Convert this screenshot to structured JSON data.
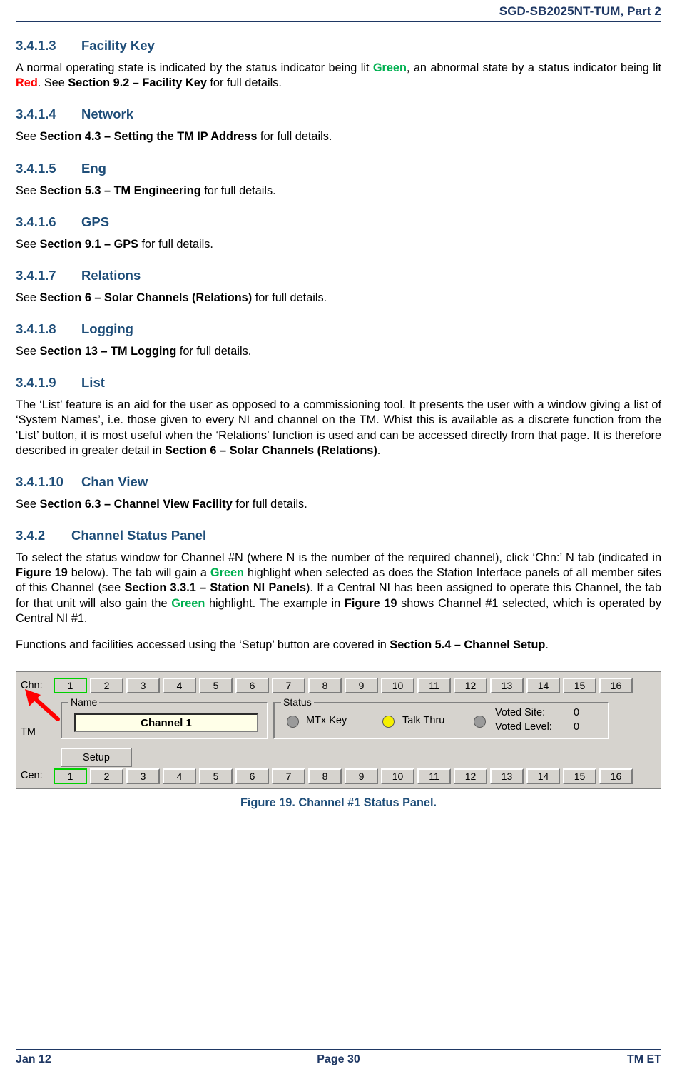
{
  "header": {
    "title": "SGD-SB2025NT-TUM, Part 2"
  },
  "sections": [
    {
      "num": "3.4.1.3",
      "title": "Facility Key",
      "paragraphs": [
        "A normal operating state is indicated by the status indicator being lit Green, an abnormal state by a status indicator being lit Red.  See Section 9.2 – Facility Key for full details."
      ]
    },
    {
      "num": "3.4.1.4",
      "title": "Network",
      "paragraphs": [
        "See Section 4.3 – Setting the TM IP Address for full details."
      ]
    },
    {
      "num": "3.4.1.5",
      "title": "Eng",
      "paragraphs": [
        "See Section 5.3 – TM Engineering for full details."
      ]
    },
    {
      "num": "3.4.1.6",
      "title": "GPS",
      "paragraphs": [
        "See Section 9.1 – GPS for full details."
      ]
    },
    {
      "num": "3.4.1.7",
      "title": "Relations",
      "paragraphs": [
        "See Section 6 – Solar Channels (Relations) for full details."
      ]
    },
    {
      "num": "3.4.1.8",
      "title": "Logging",
      "paragraphs": [
        "See Section 13 – TM Logging for full details."
      ]
    },
    {
      "num": "3.4.1.9",
      "title": "List",
      "paragraphs": [
        "The ‘List’ feature is an aid for the user as opposed to a commissioning tool.  It presents the user with a window giving a list of ‘System Names’, i.e. those given to every NI and channel on the TM.  Whist this is available as a discrete function from the ‘List’ button, it is most useful when the ‘Relations’ function is used and can be accessed directly from that page.  It is therefore described in greater detail in Section 6 – Solar Channels (Relations)."
      ]
    },
    {
      "num": "3.4.1.10",
      "title": "Chan View",
      "paragraphs": [
        "See Section 6.3 – Channel View Facility for full details."
      ]
    },
    {
      "num": "3.4.2",
      "title": "Channel Status Panel",
      "paragraphs": [
        "To select the status window for Channel #N (where N is the number of the required channel), click ‘Chn:’ N tab (indicated in Figure 19 below).  The tab will gain a Green highlight when selected as does the Station Interface panels of all member sites of this Channel (see Section 3.3.1 – Station NI Panels).  If a Central NI has been assigned to operate this Channel, the tab for that unit will also gain the Green highlight.  The example in Figure 19 shows Channel #1 selected, which is operated by Central NI #1.",
        "Functions and facilities accessed using the ‘Setup’ button are covered in Section 5.4 – Channel Setup."
      ]
    }
  ],
  "text_fragments": {
    "s3413_p1_a": "A normal operating state is indicated by the status indicator being lit ",
    "s3413_green": "Green",
    "s3413_p1_b": ", an abnormal state by a status indicator being lit ",
    "s3413_red": "Red",
    "s3413_p1_c": ".  See ",
    "s3413_ref": "Section 9.2 – Facility Key",
    "s3413_p1_d": " for full details.",
    "s3414_see": "See ",
    "s3414_ref": "Section 4.3 – Setting the TM IP Address",
    "s3414_tail": " for full details.",
    "s3415_see": "See ",
    "s3415_ref": "Section 5.3 – TM Engineering",
    "s3415_tail": " for full details.",
    "s3416_see": "See ",
    "s3416_ref": "Section 9.1 – GPS",
    "s3416_tail": " for full details.",
    "s3417_see": "See ",
    "s3417_ref": "Section 6 – Solar Channels (Relations)",
    "s3417_tail": " for full details.",
    "s3418_see": "See ",
    "s3418_ref": "Section 13 – TM Logging",
    "s3418_tail": " for full details.",
    "s3419_body": "The ‘List’ feature is an aid for the user as opposed to a commissioning tool.  It presents the user with a window giving a list of ‘System Names’, i.e. those given to every NI and channel on the TM.  Whist this is available as a discrete function from the ‘List’ button, it is most useful when the ‘Relations’ function is used and can be accessed directly from that page.  It is therefore described in greater detail in ",
    "s3419_ref": "Section 6 – Solar Channels (Relations)",
    "s3419_tail": ".",
    "s34110_see": "See ",
    "s34110_ref": "Section 6.3 – Channel View Facility",
    "s34110_tail": " for full details.",
    "s342_a": "To select the status window for Channel #N (where N is the number of the required channel), click ‘Chn:’ N tab (indicated in ",
    "s342_fig1": "Figure 19",
    "s342_b": " below).  The tab will gain a ",
    "s342_green1": "Green",
    "s342_c": " highlight when selected as does the Station Interface panels of all member sites of this Channel (see ",
    "s342_ref1": "Section 3.3.1 – Station NI Panels",
    "s342_d": ").  If a Central NI has been assigned to operate this Channel, the tab for that unit will also gain the ",
    "s342_green2": "Green",
    "s342_e": " highlight.  The example in ",
    "s342_fig2": "Figure 19",
    "s342_f": " shows Channel #1 selected, which is operated by Central NI #1.",
    "s342_p2_a": "Functions and facilities accessed using the ‘Setup’ button are covered in ",
    "s342_p2_ref": "Section 5.4 – Channel Setup",
    "s342_p2_b": "."
  },
  "figure": {
    "caption": "Figure 19.  Channel #1 Status Panel.",
    "labels": {
      "chn": "Chn:",
      "tm": "TM",
      "cen": "Cen:"
    },
    "chn_tabs": [
      "1",
      "2",
      "3",
      "4",
      "5",
      "6",
      "7",
      "8",
      "9",
      "10",
      "11",
      "12",
      "13",
      "14",
      "15",
      "16"
    ],
    "cen_tabs": [
      "1",
      "2",
      "3",
      "4",
      "5",
      "6",
      "7",
      "8",
      "9",
      "10",
      "11",
      "12",
      "13",
      "14",
      "15",
      "16"
    ],
    "chn_selected": "1",
    "cen_selected": "1",
    "name_group_title": "Name",
    "name_value": "Channel 1",
    "status_group_title": "Status",
    "status_items": [
      {
        "label": "MTx Key",
        "led": "grey"
      },
      {
        "label": "Talk Thru",
        "led": "yellow"
      }
    ],
    "voted_site_label": "Voted Site:",
    "voted_site_value": "0",
    "voted_level_label": "Voted Level:",
    "voted_level_value": "0",
    "setup_button": "Setup",
    "selection_color": "#00D000",
    "arrow_color": "#FF0000"
  },
  "footer": {
    "left": "Jan 12",
    "center": "Page 30",
    "right": "TM ET"
  }
}
